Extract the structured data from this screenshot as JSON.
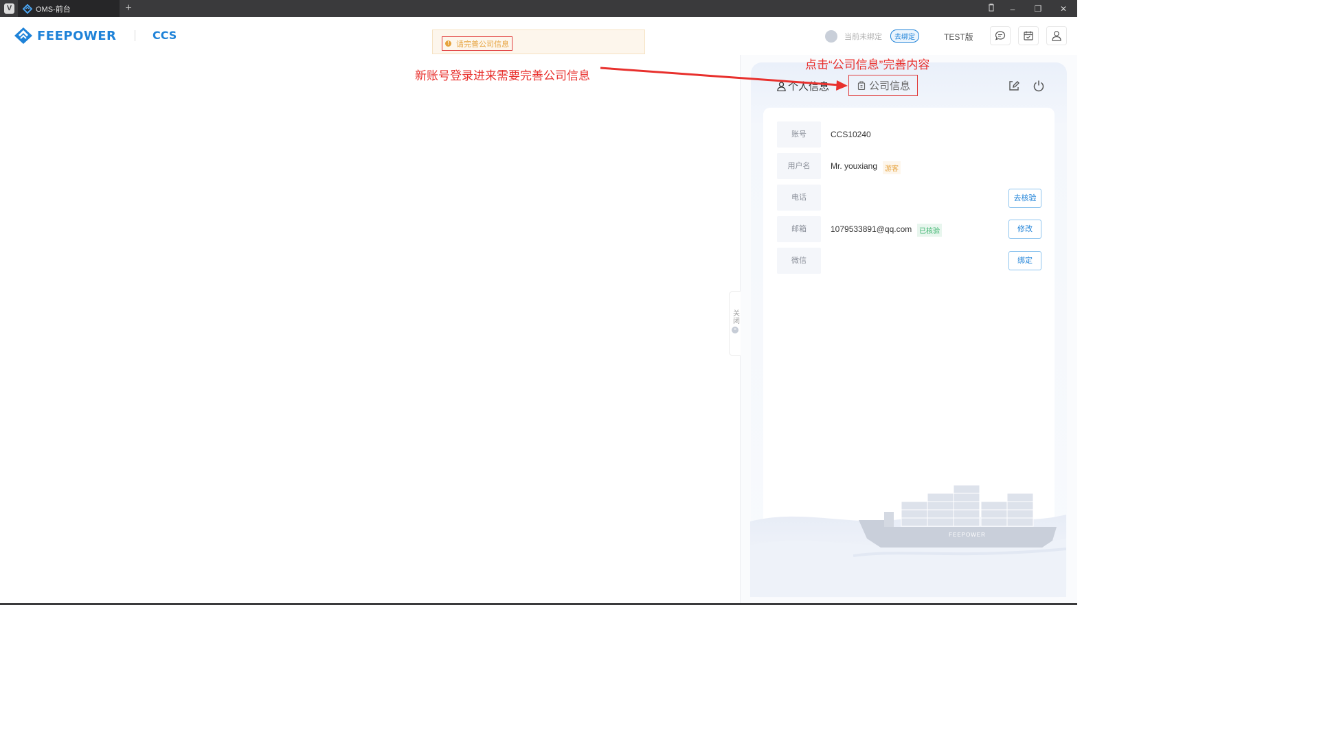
{
  "window": {
    "tab_title": "OMS-前台",
    "new_tab_symbol": "+",
    "controls": {
      "trash": "🗑",
      "minimize": "–",
      "restore": "❐",
      "close": "✕"
    }
  },
  "header": {
    "brand": "FEEPOWER",
    "product": "CCS",
    "alert_text": "请完善公司信息",
    "bind_status_text": "当前未绑定",
    "bind_button": "去绑定",
    "version_label": "TEST版"
  },
  "annotations": {
    "left_note": "新账号登录进来需要完善公司信息",
    "right_note": "点击“公司信息”完善内容"
  },
  "panel": {
    "tabs": {
      "personal": "个人信息",
      "company": "公司信息"
    },
    "rows": [
      {
        "label": "账号",
        "value": "CCS10240",
        "tag": "",
        "button": ""
      },
      {
        "label": "用户名",
        "value": "Mr. youxiang",
        "tag": "游客",
        "button": ""
      },
      {
        "label": "电话",
        "value": "",
        "tag": "",
        "button": "去核验"
      },
      {
        "label": "邮箱",
        "value": "1079533891@qq.com",
        "tag": "已核验",
        "button": "修改"
      },
      {
        "label": "微信",
        "value": "",
        "tag": "",
        "button": "绑定"
      }
    ],
    "close_label": "关闭",
    "ship_brand": "FEEPOWER"
  },
  "colors": {
    "brand_blue": "#1e82d8",
    "annotation_red": "#e8302d",
    "warning_orange": "#e6a23c",
    "success_green": "#3cb46e"
  }
}
